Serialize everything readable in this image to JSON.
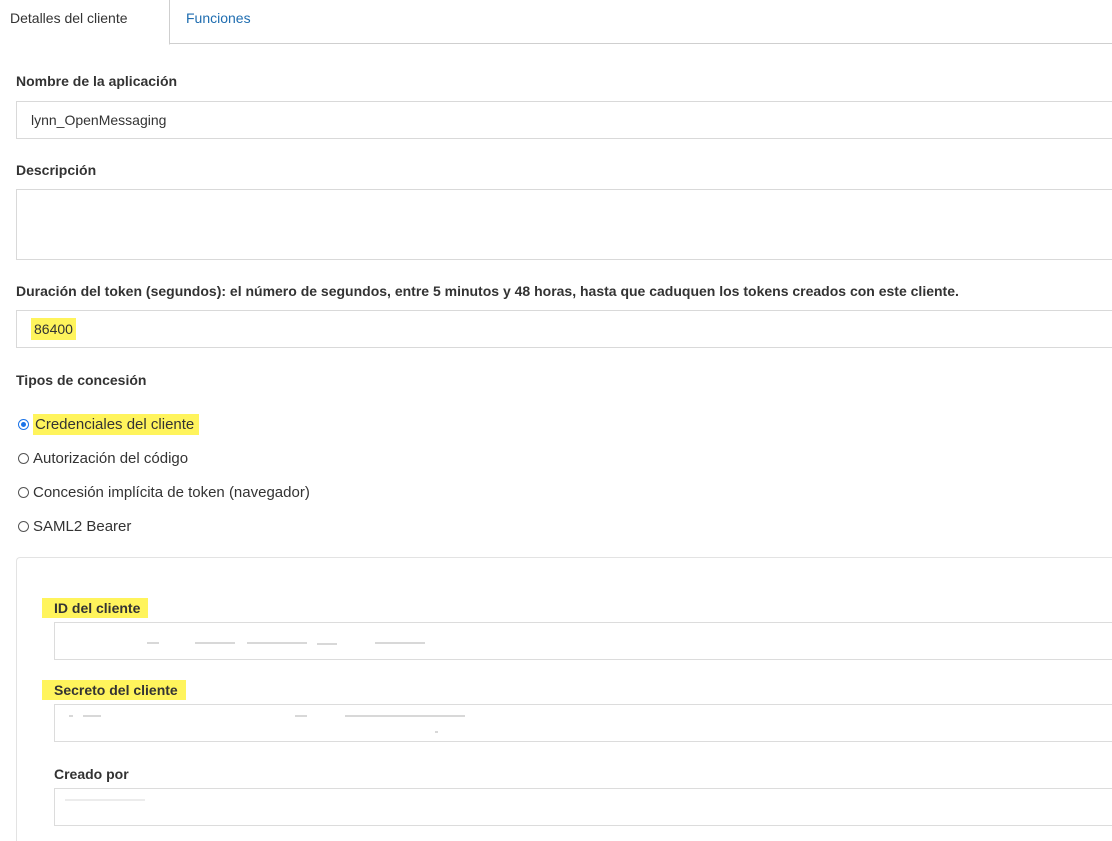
{
  "tabs": [
    {
      "label": "Detalles del cliente",
      "active": true
    },
    {
      "label": "Funciones",
      "active": false
    }
  ],
  "form": {
    "app_name_label": "Nombre de la aplicación",
    "app_name_value": "lynn_OpenMessaging",
    "description_label": "Descripción",
    "description_value": "",
    "token_duration_label": "Duración del token (segundos): el número de segundos, entre 5 minutos y 48 horas, hasta que caduquen los tokens creados con este cliente.",
    "token_duration_value": "86400",
    "grant_types_label": "Tipos de concesión",
    "grant_types": [
      {
        "label": "Credenciales del cliente",
        "selected": true
      },
      {
        "label": "Autorización del código",
        "selected": false
      },
      {
        "label": "Concesión implícita de token (navegador)",
        "selected": false
      },
      {
        "label": "SAML2 Bearer",
        "selected": false
      }
    ]
  },
  "client_panel": {
    "client_id_label": "ID del cliente",
    "client_secret_label": "Secreto del cliente",
    "created_by_label": "Creado por"
  },
  "colors": {
    "highlight": "#fff45c",
    "tab_link": "#1f6db0",
    "radio_selected": "#1a73e8",
    "border": "#d9d9d9"
  },
  "icons": {
    "radio_selected": "radio-selected-icon",
    "radio_unselected": "radio-unselected-icon"
  }
}
